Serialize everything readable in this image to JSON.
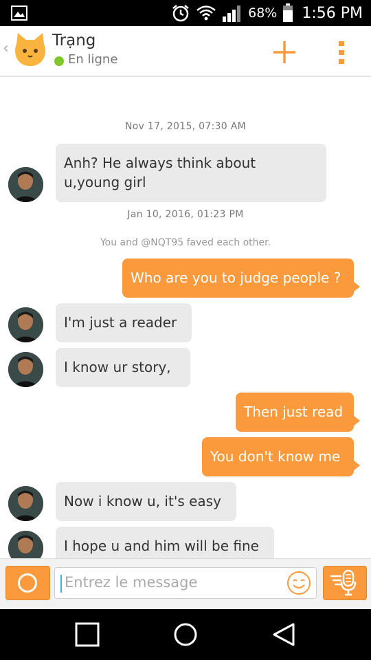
{
  "status_bar": {
    "battery": "68%",
    "time": "1:56 PM"
  },
  "header": {
    "back": "‹",
    "contact_name": "Trạng",
    "status": "En ligne",
    "accent": "#fa9a3c"
  },
  "chat": {
    "date1": "Nov 17, 2015, 07:30 AM",
    "msg1_line1": "Anh? He always think about",
    "msg1_line2": "u,young girl",
    "date2": "Jan 10, 2016, 01:23 PM",
    "system": "You and @NQT95 faved each other.",
    "msg2": "Who are you to judge people ?",
    "msg3": "I'm just a reader",
    "msg4": "I know ur story,",
    "msg5": "Then just read",
    "msg6": "You don't know me",
    "msg7": "Now i know u, it's easy",
    "msg8": "I hope u and him will be fine"
  },
  "composer": {
    "placeholder": "Entrez le message"
  }
}
